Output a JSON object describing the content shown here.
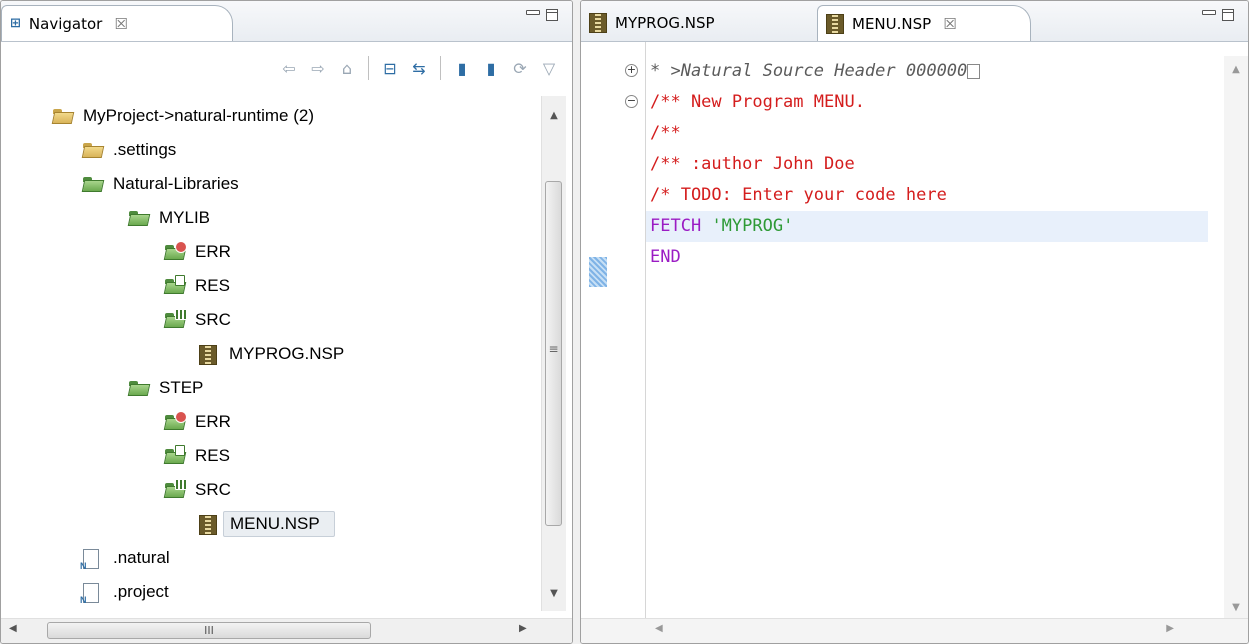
{
  "navigator": {
    "tab_label": "Navigator",
    "tab_close": "☒",
    "toolbar": [
      {
        "name": "back-icon",
        "glyph": "⇦"
      },
      {
        "name": "forward-icon",
        "glyph": "⇨"
      },
      {
        "name": "home-icon",
        "glyph": "⌂"
      },
      {
        "name": "collapse-all-icon",
        "glyph": "⊟"
      },
      {
        "name": "link-with-editor-icon",
        "glyph": "⇆"
      },
      {
        "name": "new-source-icon",
        "glyph": "▮"
      },
      {
        "name": "new-library-icon",
        "glyph": "▮"
      },
      {
        "name": "sync-icon",
        "glyph": "⟳"
      },
      {
        "name": "view-menu-icon",
        "glyph": "▽"
      }
    ],
    "tree": [
      {
        "label": "MyProject->natural-runtime (2)",
        "level": 0,
        "icon": "project"
      },
      {
        "label": ".settings",
        "level": 1,
        "icon": "folder"
      },
      {
        "label": "Natural-Libraries",
        "level": 1,
        "icon": "folder-green"
      },
      {
        "label": "MYLIB",
        "level": 2,
        "icon": "folder-green"
      },
      {
        "label": "ERR",
        "level": 3,
        "icon": "folder-err"
      },
      {
        "label": "RES",
        "level": 3,
        "icon": "folder-res"
      },
      {
        "label": "SRC",
        "level": 3,
        "icon": "folder-src"
      },
      {
        "label": "MYPROG.NSP",
        "level": 4,
        "icon": "nsp"
      },
      {
        "label": "STEP",
        "level": 2,
        "icon": "folder-green"
      },
      {
        "label": "ERR",
        "level": 3,
        "icon": "folder-err"
      },
      {
        "label": "RES",
        "level": 3,
        "icon": "folder-res"
      },
      {
        "label": "SRC",
        "level": 3,
        "icon": "folder-src"
      },
      {
        "label": "MENU.NSP",
        "level": 4,
        "icon": "nsp",
        "selected": true
      },
      {
        "label": ".natural",
        "level": 1,
        "icon": "nfile"
      },
      {
        "label": ".project",
        "level": 1,
        "icon": "nfile"
      }
    ],
    "hscroll_grip": "III",
    "vscroll_grip": "≡"
  },
  "editor": {
    "tabs": [
      {
        "label": "MYPROG.NSP",
        "active": false
      },
      {
        "label": "MENU.NSP",
        "active": true,
        "close": "☒"
      }
    ],
    "code": [
      {
        "text": "* >Natural Source Header 000000",
        "style": "comment-i",
        "fold": "+",
        "ellipsis": true
      },
      {
        "text": "/** New Program MENU.",
        "style": "comment",
        "fold": "−"
      },
      {
        "text": "/**",
        "style": "comment"
      },
      {
        "text": "/** :author John Doe",
        "style": "comment"
      },
      {
        "text": "/* TODO: Enter your code here",
        "style": "comment"
      },
      {
        "keyword": "FETCH",
        "string": "'MYPROG'",
        "current": true
      },
      {
        "keyword": "END"
      }
    ]
  },
  "colors": {
    "comment": "#d41d1d",
    "keyword": "#9b1cc4",
    "string": "#2e9a36",
    "current_line": "#e8f0fb"
  }
}
